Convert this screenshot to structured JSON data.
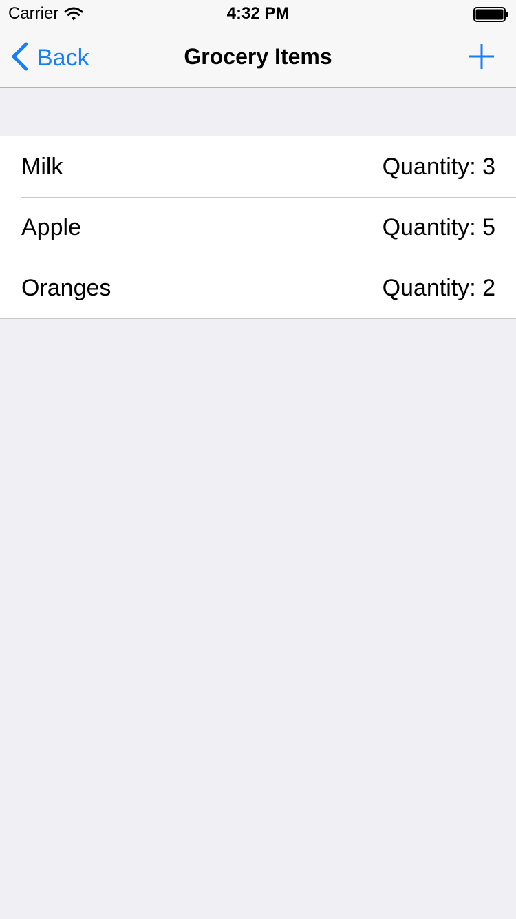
{
  "status_bar": {
    "carrier": "Carrier",
    "time": "4:32 PM"
  },
  "nav": {
    "back_label": "Back",
    "title": "Grocery Items",
    "add_icon": "plus-icon"
  },
  "accent_color": "#157efb",
  "items": [
    {
      "name": "Milk",
      "quantity": "Quantity: 3"
    },
    {
      "name": "Apple",
      "quantity": "Quantity: 5"
    },
    {
      "name": "Oranges",
      "quantity": "Quantity: 2"
    }
  ]
}
